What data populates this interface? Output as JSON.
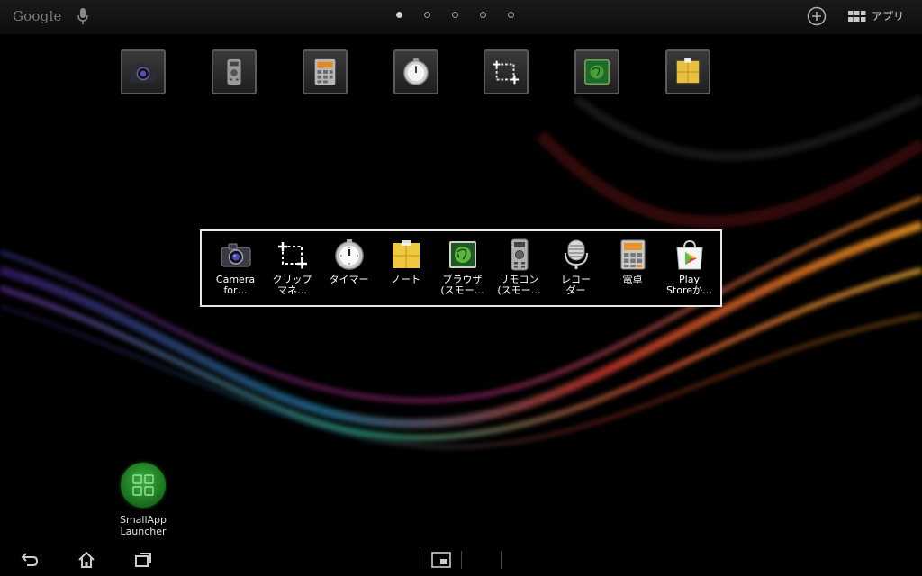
{
  "topbar": {
    "google_label": "Google",
    "apps_label": "アプリ"
  },
  "page_indicator": {
    "count": 5,
    "active": 0
  },
  "home_icons": [
    {
      "icon": "camera-icon"
    },
    {
      "icon": "remote-icon"
    },
    {
      "icon": "calculator-icon"
    },
    {
      "icon": "timer-icon"
    },
    {
      "icon": "clip-icon"
    },
    {
      "icon": "browser-icon"
    },
    {
      "icon": "note-icon"
    }
  ],
  "small_apps": [
    {
      "label": "Camera\nfor…",
      "icon": "camera-icon"
    },
    {
      "label": "クリップ\nマネ…",
      "icon": "clip-icon"
    },
    {
      "label": "タイマー",
      "icon": "timer-icon"
    },
    {
      "label": "ノート",
      "icon": "note-icon"
    },
    {
      "label": "ブラウザ\n(スモー…",
      "icon": "browser-icon"
    },
    {
      "label": "リモコン\n(スモー…",
      "icon": "remote-icon"
    },
    {
      "label": "レコー\nダー",
      "icon": "microphone-icon"
    },
    {
      "label": "電卓",
      "icon": "calculator-icon"
    },
    {
      "label": "Play\nStoreか…",
      "icon": "play-store-icon"
    }
  ],
  "launcher": {
    "label": "SmallApp Launcher"
  }
}
